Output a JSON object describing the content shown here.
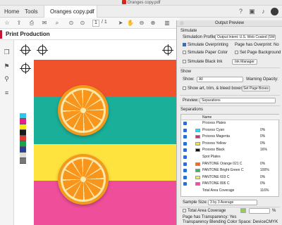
{
  "window": {
    "title": "Oranges copy.pdf"
  },
  "tabs": {
    "home": "Home",
    "tools": "Tools",
    "document": "Oranges copy.pdf",
    "close": "×"
  },
  "toolbar": {
    "page_current": "1",
    "page_total": "/ 1"
  },
  "print_production": {
    "label": "Print Production"
  },
  "document": {
    "stripe_colors": [
      "#f0522c",
      "#1aaf98",
      "#fee23e",
      "#ee4e9a"
    ],
    "color_bar": [
      "#30c4ee",
      "#ea1d8c",
      "#f7e71a",
      "#1a1a1a",
      "#e23b2c",
      "#18a24a",
      "#2b3ea0",
      "#dcdcdc",
      "#777777"
    ]
  },
  "panel": {
    "title": "Output Preview",
    "simulate_header": "Simulate",
    "simulation_profile_label": "Simulation Profile:",
    "simulation_profile_value": "Output Intent: U.S. Web Coated (SWOP)...",
    "simulate_overprinting": "Simulate Overprinting",
    "page_has_overprint_label": "Page has Overprint:",
    "page_has_overprint_value": "No",
    "simulate_paper_color": "Simulate Paper Color",
    "set_page_background_color": "Set Page Background Color",
    "simulate_black_ink": "Simulate Black Ink",
    "ink_manager": "Ink Manager",
    "show_header": "Show",
    "show_label": "Show:",
    "show_value": "All",
    "warning_opacity": "Warning Opacity:",
    "show_art_trim": "Show art, trim, & bleed boxes",
    "set_page_boxes": "Set Page Boxes",
    "preview_label": "Preview:",
    "preview_value": "Separations",
    "separations_header": "Separations",
    "col_name": "Name",
    "separations": [
      {
        "name": "Process Plates",
        "swatch": "",
        "pct": ""
      },
      {
        "name": "Process Cyan",
        "swatch": "#30d5f0",
        "pct": "0%"
      },
      {
        "name": "Process Magenta",
        "swatch": "#ea1d8c",
        "pct": "0%"
      },
      {
        "name": "Process Yellow",
        "swatch": "#f7e71a",
        "pct": "0%"
      },
      {
        "name": "Process Black",
        "swatch": "#111111",
        "pct": "16%"
      },
      {
        "name": "Spot Plates",
        "swatch": "",
        "pct": ""
      },
      {
        "name": "PANTONE Orange 021 C",
        "swatch": "#f26a1f",
        "pct": "0%"
      },
      {
        "name": "PANTONE Bright Green C",
        "swatch": "#1fc35a",
        "pct": "100%"
      },
      {
        "name": "PANTONE 603 C",
        "swatch": "#eef04a",
        "pct": "0%"
      },
      {
        "name": "PANTONE 806 C",
        "swatch": "#ee4ea2",
        "pct": "0%"
      },
      {
        "name": "Total Area Coverage",
        "swatch": "",
        "pct": "116%"
      }
    ],
    "sample_size_label": "Sample Size:",
    "sample_size_value": "3 by 3 Average",
    "total_area_coverage": "Total Area Coverage",
    "tac_value": "",
    "tac_unit": "%",
    "page_has_transparency_label": "Page has Transparency:",
    "page_has_transparency_value": "Yes",
    "blending_space_label": "Transparency Blending Color Space:",
    "blending_space_value": "DeviceCMYK"
  }
}
